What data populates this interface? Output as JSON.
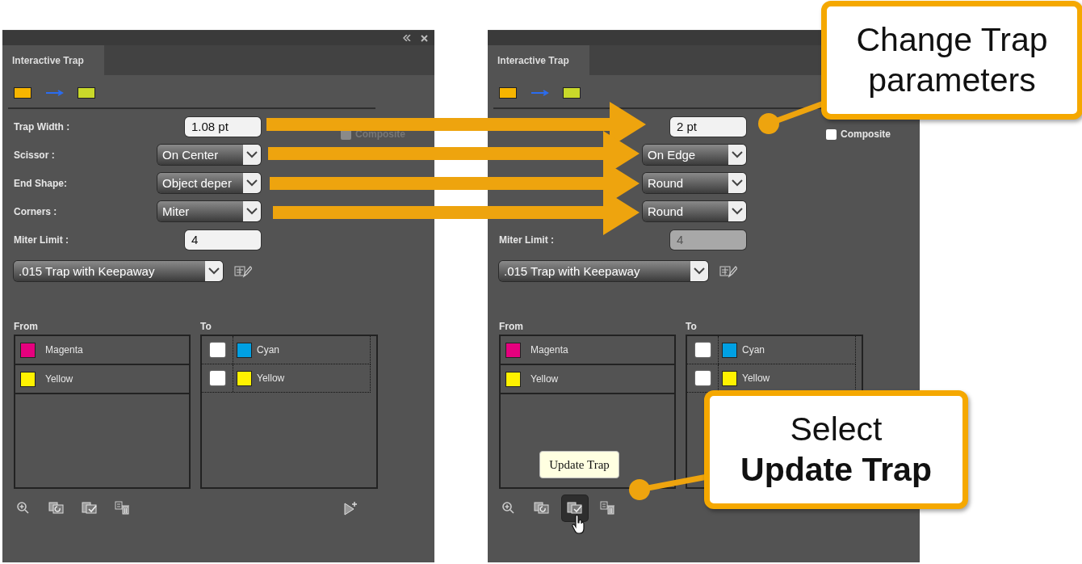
{
  "panels": [
    {
      "window_controls": true,
      "tab": "Interactive Trap",
      "trap_pair": [
        {
          "color": "#f7b500"
        },
        {
          "color": "#c9d92a"
        }
      ],
      "fields": [
        {
          "kind": "text",
          "label": "Trap Width :",
          "value": "1.08 pt",
          "disabled": false
        },
        {
          "kind": "select",
          "label": "Scissor :",
          "value": "On Center",
          "disabled": false
        },
        {
          "kind": "select",
          "label": "End Shape:",
          "value": "Object deper",
          "disabled": false
        },
        {
          "kind": "select",
          "label": "Corners :",
          "value": "Miter",
          "disabled": false
        },
        {
          "kind": "text",
          "label": "Miter Limit :",
          "value": "4",
          "disabled": false
        }
      ],
      "composite": {
        "label": "Composite",
        "checked": false,
        "disabled": true
      },
      "preset": ".015 Trap with Keepaway",
      "from_label": "From",
      "from": [
        {
          "name": "Magenta",
          "color": "#e6007e"
        },
        {
          "name": "Yellow",
          "color": "#fff200"
        }
      ],
      "to_label": "To",
      "to": [
        {
          "name": "Cyan",
          "color": "#00a0e3",
          "checked": false
        },
        {
          "name": "Yellow",
          "color": "#fff200",
          "checked": false
        }
      ],
      "tools": [
        {
          "kind": "zoom",
          "selected": false
        },
        {
          "kind": "reset",
          "selected": false
        },
        {
          "kind": "update",
          "selected": false
        },
        {
          "kind": "delete",
          "selected": false
        },
        {
          "kind": "add",
          "selected": false
        }
      ]
    },
    {
      "window_controls": false,
      "tab": "Interactive Trap",
      "trap_pair": [
        {
          "color": "#f7b500"
        },
        {
          "color": "#c9d92a"
        }
      ],
      "fields": [
        {
          "kind": "text",
          "value": "2 pt",
          "disabled": false
        },
        {
          "kind": "select",
          "value": "On Edge",
          "disabled": false
        },
        {
          "kind": "select",
          "value": "Round",
          "disabled": false
        },
        {
          "kind": "select",
          "value": "Round",
          "disabled": false
        },
        {
          "kind": "text",
          "label": "Miter Limit :",
          "value": "4",
          "disabled": true
        }
      ],
      "composite": {
        "label": "Composite",
        "checked": false,
        "disabled": false
      },
      "preset": ".015 Trap with Keepaway",
      "from_label": "From",
      "from": [
        {
          "name": "Magenta",
          "color": "#e6007e"
        },
        {
          "name": "Yellow",
          "color": "#fff200"
        }
      ],
      "to_label": "To",
      "to": [
        {
          "name": "Cyan",
          "color": "#00a0e3",
          "checked": false
        },
        {
          "name": "Yellow",
          "color": "#fff200",
          "checked": false
        }
      ],
      "tools": [
        {
          "kind": "zoom",
          "selected": false
        },
        {
          "kind": "reset",
          "selected": false
        },
        {
          "kind": "update",
          "selected": true
        },
        {
          "kind": "delete",
          "selected": false
        }
      ],
      "tooltip": "Update Trap"
    }
  ],
  "callouts": [
    {
      "text": "Change Trap parameters"
    },
    {
      "text": "Select **Update Trap**"
    }
  ]
}
